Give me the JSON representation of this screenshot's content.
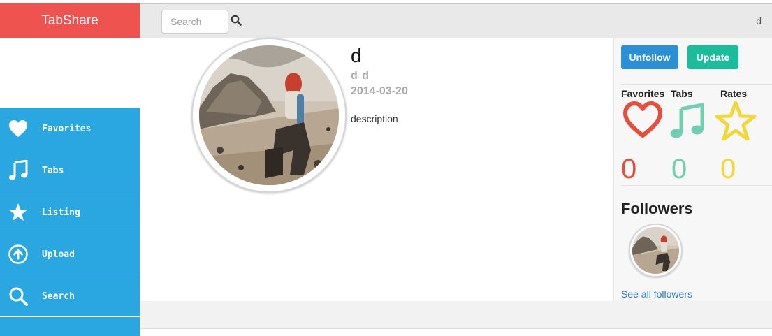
{
  "brand": {
    "title": "TabShare",
    "color": "#ef5350"
  },
  "topbar": {
    "search_placeholder": "Search",
    "search_icon": "search-icon",
    "user": "d"
  },
  "sidebar": {
    "color": "#2aa7e0",
    "items": [
      {
        "label": "Favorites",
        "icon": "heart-icon"
      },
      {
        "label": "Tabs",
        "icon": "music-note-icon"
      },
      {
        "label": "Listing",
        "icon": "star-icon"
      },
      {
        "label": "Upload",
        "icon": "upload-icon"
      },
      {
        "label": "Search",
        "icon": "search-icon"
      }
    ]
  },
  "profile": {
    "username": "d",
    "full_name": "d d",
    "date": "2014-03-20",
    "description": "description"
  },
  "panel": {
    "unfollow_label": "Unfollow",
    "update_label": "Update",
    "stats": [
      {
        "label": "Favorites",
        "icon": "heart-icon",
        "count": "0",
        "color": "#e74c3c"
      },
      {
        "label": "Tabs",
        "icon": "music-note-icon",
        "count": "0",
        "color": "#6fcfb0"
      },
      {
        "label": "Rates",
        "icon": "star-icon",
        "count": "0",
        "color": "#f1d73a"
      }
    ],
    "followers_title": "Followers",
    "see_all_label": "See all followers"
  }
}
